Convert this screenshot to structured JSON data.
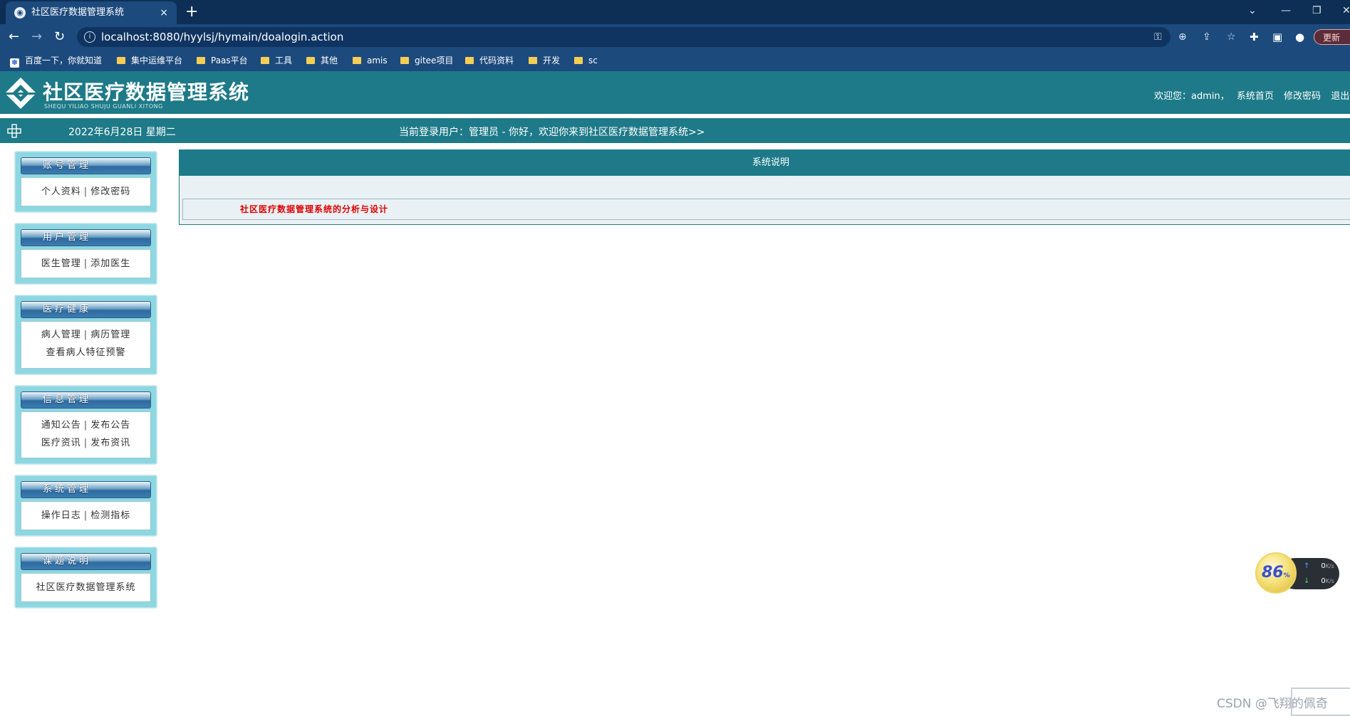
{
  "browser": {
    "tab_title": "社区医疗数据管理系统",
    "tab_close": "×",
    "new_tab": "+",
    "url": "localhost:8080/hyylsj/hymain/doalogin.action",
    "update_label": "更新",
    "bookmarks": [
      {
        "label": "百度一下，你就知道",
        "icon": "baidu-icon"
      },
      {
        "label": "集中运维平台",
        "icon": "folder-icon"
      },
      {
        "label": "Paas平台",
        "icon": "folder-icon"
      },
      {
        "label": "工具",
        "icon": "folder-icon"
      },
      {
        "label": "其他",
        "icon": "folder-icon"
      },
      {
        "label": "amis",
        "icon": "folder-icon"
      },
      {
        "label": "gitee项目",
        "icon": "folder-icon"
      },
      {
        "label": "代码资料",
        "icon": "folder-icon"
      },
      {
        "label": "开发",
        "icon": "folder-icon"
      },
      {
        "label": "sc",
        "icon": "folder-icon"
      }
    ]
  },
  "header": {
    "title": "社区医疗数据管理系统",
    "subtitle": "SHEQU YILIAO SHUJU GUANLI XITONG",
    "welcome_prefix": "欢迎您：admin，",
    "links": [
      "系统首页",
      "修改密码",
      "退出登"
    ]
  },
  "info_bar": {
    "date": "2022年6月28日 星期二",
    "welcome": "当前登录用户：管理员 - 你好，欢迎你来到社区医疗数据管理系统>>"
  },
  "sidebar": {
    "sections": [
      {
        "title": "账号管理",
        "rows": [
          [
            "个人资料",
            "修改密码"
          ]
        ]
      },
      {
        "title": "用户管理",
        "rows": [
          [
            "医生管理",
            "添加医生"
          ]
        ]
      },
      {
        "title": "医疗健康",
        "rows": [
          [
            "病人管理",
            "病历管理"
          ],
          [
            "查看病人特征预警"
          ]
        ]
      },
      {
        "title": "信息管理",
        "rows": [
          [
            "通知公告",
            "发布公告"
          ],
          [
            "医疗资讯",
            "发布资讯"
          ]
        ]
      },
      {
        "title": "系统管理",
        "rows": [
          [
            "操作日志",
            "检测指标"
          ]
        ]
      },
      {
        "title": "课题说明",
        "rows": [
          [
            "社区医疗数据管理系统"
          ]
        ]
      }
    ],
    "separator": "|"
  },
  "main": {
    "panel_title": "系统说明",
    "description_link": "社区医疗数据管理系统的分析与设计"
  },
  "speed_widget": {
    "percent": "86",
    "percent_unit": "%",
    "up": "0",
    "down": "0",
    "unit": "K/s"
  },
  "watermark": "CSDN @飞翔的佩奇"
}
